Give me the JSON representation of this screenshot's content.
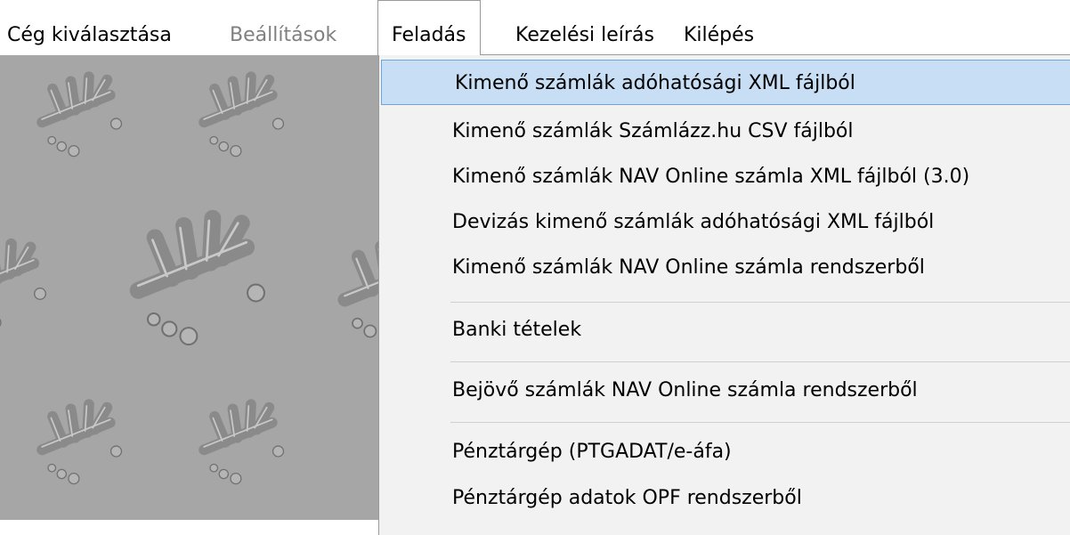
{
  "menubar": {
    "items": [
      {
        "label": "Cég kiválasztása",
        "state": "normal"
      },
      {
        "label": "Beállítások",
        "state": "disabled"
      },
      {
        "label": "Feladás",
        "state": "open"
      },
      {
        "label": "Kezelési leírás",
        "state": "normal"
      },
      {
        "label": "Kilépés",
        "state": "normal"
      }
    ]
  },
  "dropdown": {
    "items": [
      {
        "label": "Kimenő számlák adóhatósági XML fájlból",
        "selected": true
      },
      {
        "label": "Kimenő számlák Számlázz.hu CSV fájlból"
      },
      {
        "label": "Kimenő számlák NAV Online számla XML fájlból (3.0)"
      },
      {
        "label": "Devizás kimenő számlák adóhatósági XML fájlból"
      },
      {
        "label": "Kimenő számlák NAV Online számla rendszerből"
      },
      {
        "label": "Banki tételek"
      },
      {
        "label": "Bejövő számlák NAV Online számla rendszerből"
      },
      {
        "label": "Pénztárgép (PTGADAT/e-áfa)"
      },
      {
        "label": "Pénztárgép adatok OPF rendszerből"
      }
    ]
  },
  "colors": {
    "workspace_background": "#a6a6a6",
    "menu_background": "#f2f2f2",
    "selection_fill": "#c7def5",
    "selection_border": "#6ea6d9",
    "disabled_text": "#808080"
  },
  "icons": [
    "logo-icon"
  ]
}
